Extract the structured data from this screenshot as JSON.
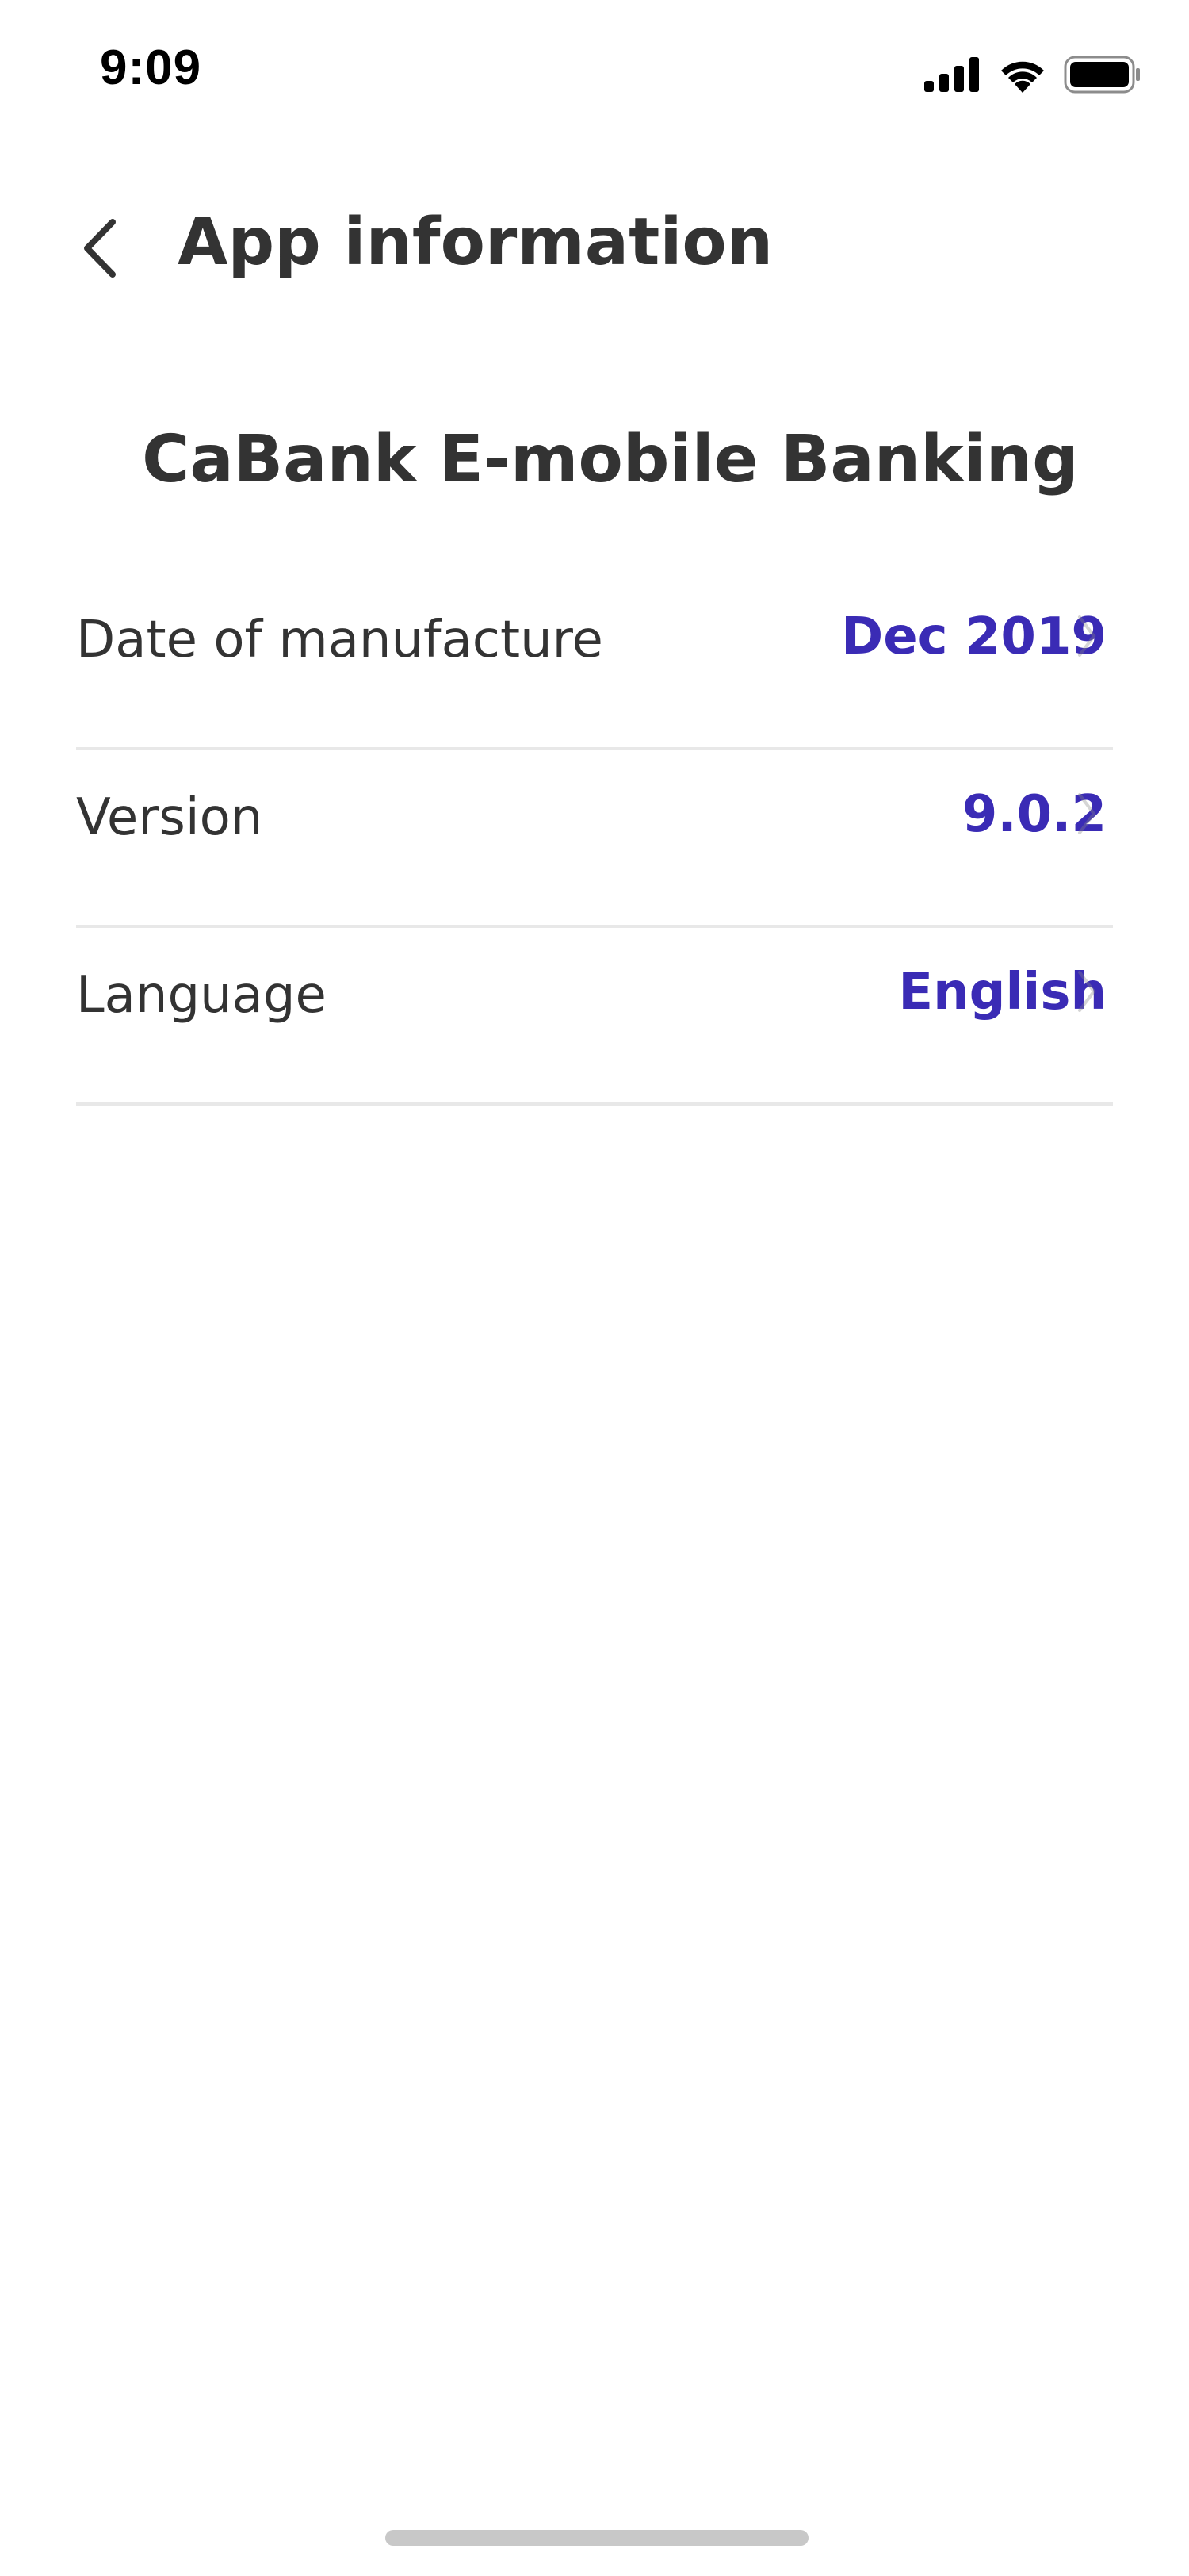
{
  "status_bar": {
    "time": "9:09",
    "icons": [
      "signal-icon",
      "wifi-icon",
      "battery-icon"
    ]
  },
  "header": {
    "back_icon": "chevron-left-icon",
    "title": "App information"
  },
  "app_name": "CaBank E-mobile Banking",
  "info_rows": [
    {
      "label": "Date of manufacture",
      "value": "Dec 2019"
    },
    {
      "label": "Version",
      "value": "9.0.2"
    },
    {
      "label": "Language",
      "value": "English"
    }
  ],
  "colors": {
    "accent": "#3a2bb5",
    "text": "#333333",
    "divider": "#e8e8e8"
  }
}
